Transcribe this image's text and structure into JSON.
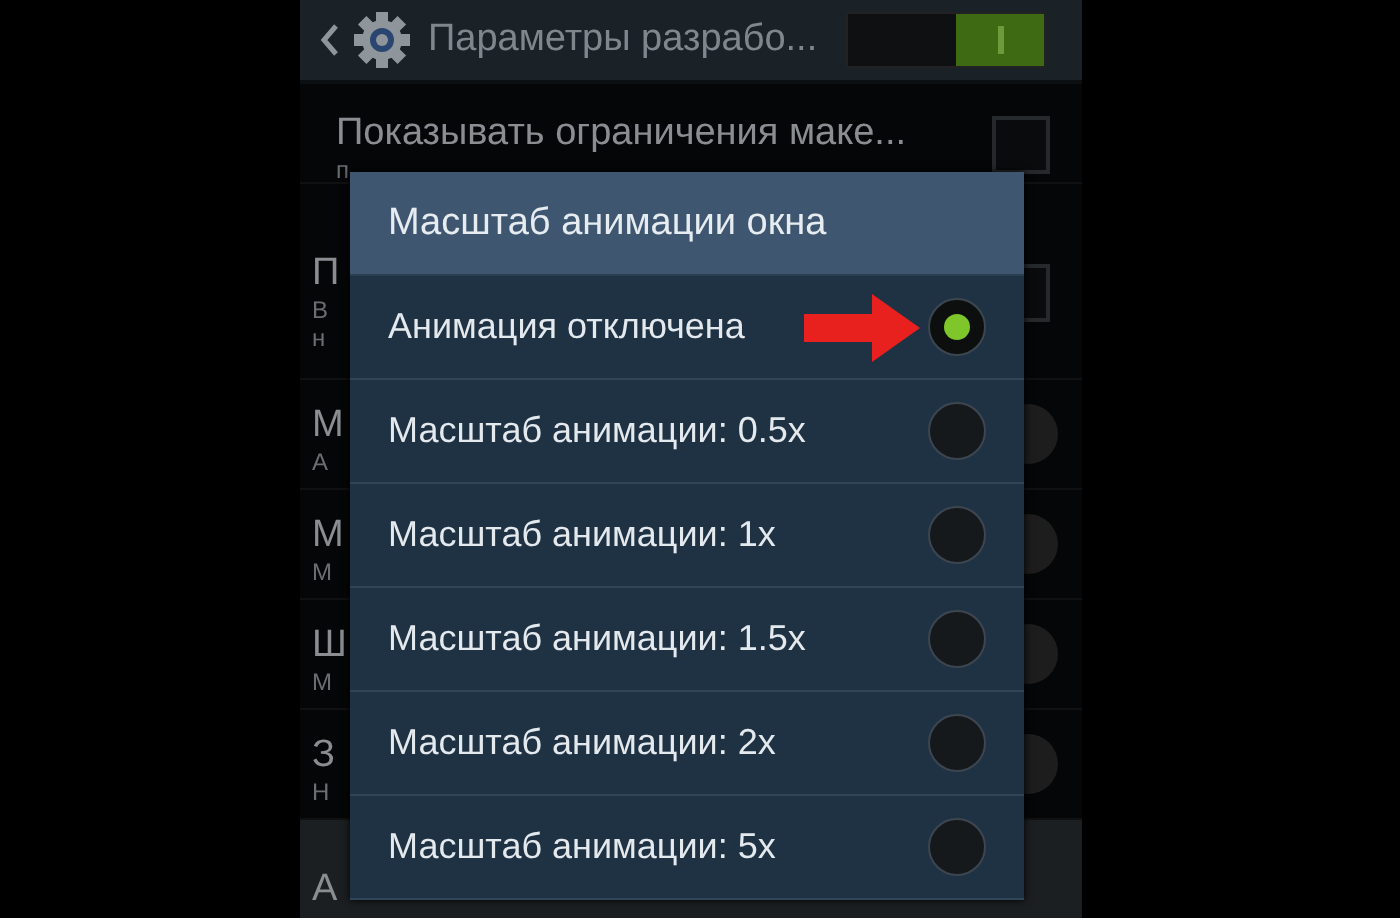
{
  "header": {
    "title": "Параметры разрабо...",
    "toggle_on": true
  },
  "background_rows": [
    {
      "kind": "checkbox",
      "title": "Показывать ограничения маке...",
      "lines": [
        "п"
      ],
      "checked": false
    },
    {
      "kind": "checkbox",
      "title": "П",
      "lines": [
        "В",
        "н"
      ],
      "checked": false
    },
    {
      "kind": "dial",
      "title": "М",
      "lines": [
        "А"
      ]
    },
    {
      "kind": "dial",
      "title": "М",
      "lines": [
        "М"
      ]
    },
    {
      "kind": "dial",
      "title": "Ш",
      "lines": [
        "М"
      ]
    },
    {
      "kind": "dial",
      "title": "З",
      "lines": [
        "Н"
      ]
    },
    {
      "kind": "section",
      "title": "А",
      "lines": []
    }
  ],
  "dialog": {
    "title": "Масштаб анимации окна",
    "options": [
      {
        "label": "Анимация отключена",
        "selected": true
      },
      {
        "label": "Масштаб анимации: 0.5x",
        "selected": false
      },
      {
        "label": "Масштаб анимации: 1x",
        "selected": false
      },
      {
        "label": "Масштаб анимации: 1.5x",
        "selected": false
      },
      {
        "label": "Масштаб анимации: 2x",
        "selected": false
      },
      {
        "label": "Масштаб анимации: 5x",
        "selected": false
      }
    ]
  }
}
